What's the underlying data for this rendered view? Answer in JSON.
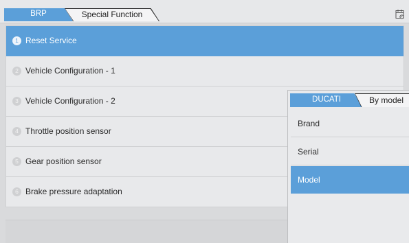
{
  "breadcrumb": {
    "items": [
      "BRP",
      "Special Function"
    ]
  },
  "top_icon": "calendar-settings-icon",
  "list": {
    "selected_index": 0,
    "items": [
      {
        "number": "1",
        "label": "Reset Service"
      },
      {
        "number": "2",
        "label": "Vehicle Configuration - 1"
      },
      {
        "number": "3",
        "label": "Vehicle Configuration - 2"
      },
      {
        "number": "4",
        "label": "Throttle position sensor"
      },
      {
        "number": "5",
        "label": "Gear position sensor"
      },
      {
        "number": "6",
        "label": "Brake pressure adaptation"
      }
    ]
  },
  "popup": {
    "breadcrumb": [
      "DUCATI",
      "By model"
    ],
    "selected_index": 2,
    "items": [
      "Brand",
      "Serial",
      "Model"
    ]
  },
  "colors": {
    "accent": "#5b9fd9",
    "background": "#d9dadc",
    "row": "#e8e9eb"
  }
}
